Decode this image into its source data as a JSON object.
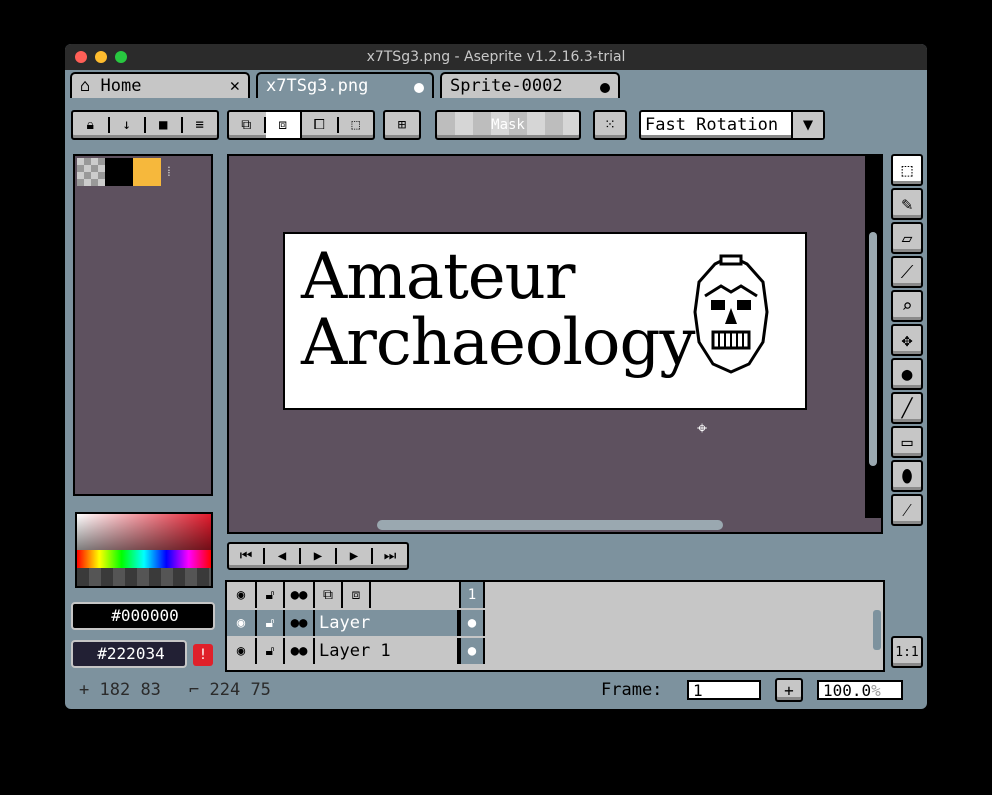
{
  "window": {
    "title": "x7TSg3.png - Aseprite v1.2.16.3-trial"
  },
  "tabs": [
    {
      "label": "Home",
      "icon": "home-icon",
      "close": "✕"
    },
    {
      "label": "x7TSg3.png"
    },
    {
      "label": "Sprite-0002"
    }
  ],
  "toolbar": {
    "mask_label": "Mask",
    "rotation_algorithm": "Fast Rotation"
  },
  "canvas": {
    "title_line1": "Amateur",
    "title_line2": "Archaeology"
  },
  "colors": {
    "fg_hex": "#000000",
    "bg_hex": "#222034",
    "palette_swatch": "#f6b83c",
    "canvas_bg": "#5e515f"
  },
  "timeline": {
    "frame_header": "1",
    "layers": [
      {
        "name": "Layer"
      },
      {
        "name": "Layer 1"
      }
    ]
  },
  "status": {
    "cursor_pos": "182 83",
    "sprite_size": "224 75",
    "frame_label": "Frame:",
    "frame_value": "1",
    "zoom": "100.0",
    "zoom_unit": "%",
    "one_to_one": "1:1"
  }
}
